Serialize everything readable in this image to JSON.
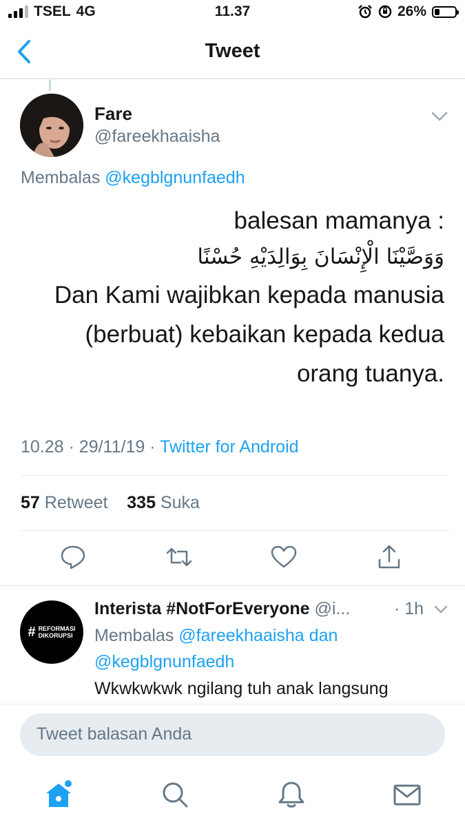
{
  "status_bar": {
    "carrier": "TSEL",
    "network": "4G",
    "time": "11.37",
    "battery": "26%",
    "battery_level": 0.26
  },
  "nav": {
    "title": "Tweet",
    "back_icon": "chevron-left-icon"
  },
  "tweet": {
    "author_name": "Fare",
    "author_handle": "@fareekhaaisha",
    "replying_prefix": "Membalas",
    "replying_to": "@kegblgnunfaedh",
    "body_lines": [
      "balesan mamanya :",
      "وَوَصَّيْنَا الْإِنْسَانَ بِوَالِدَيْهِ حُسْنًا",
      "Dan Kami wajibkan kepada manusia",
      "(berbuat) kebaikan kepada kedua",
      "orang tuanya."
    ],
    "time": "10.28",
    "date": "29/11/19",
    "source": "Twitter for Android",
    "retweet_count": "57",
    "retweet_label": "Retweet",
    "like_count": "335",
    "like_label": "Suka"
  },
  "actions": [
    "reply-icon",
    "retweet-icon",
    "like-icon",
    "share-icon"
  ],
  "reply": {
    "author_name": "Interista #NotForEveryone",
    "author_handle": "@i...",
    "time": "· 1h",
    "replying_prefix": "Membalas",
    "replying_to_1": "@fareekhaaisha",
    "conjunction": "dan",
    "replying_to_2": "@kegblgnunfaedh",
    "text": "Wkwkwkwk ngilang tuh anak langsung",
    "avatar_hash": "#",
    "avatar_line1": "REFORMASI",
    "avatar_line2": "DIKORUPSI"
  },
  "composer": {
    "placeholder": "Tweet balasan Anda"
  },
  "tab_bar": [
    "home-icon",
    "search-icon",
    "notifications-icon",
    "messages-icon"
  ],
  "colors": {
    "accent": "#1da1f2",
    "secondary_text": "#657786",
    "divider": "#e1e8ed"
  }
}
